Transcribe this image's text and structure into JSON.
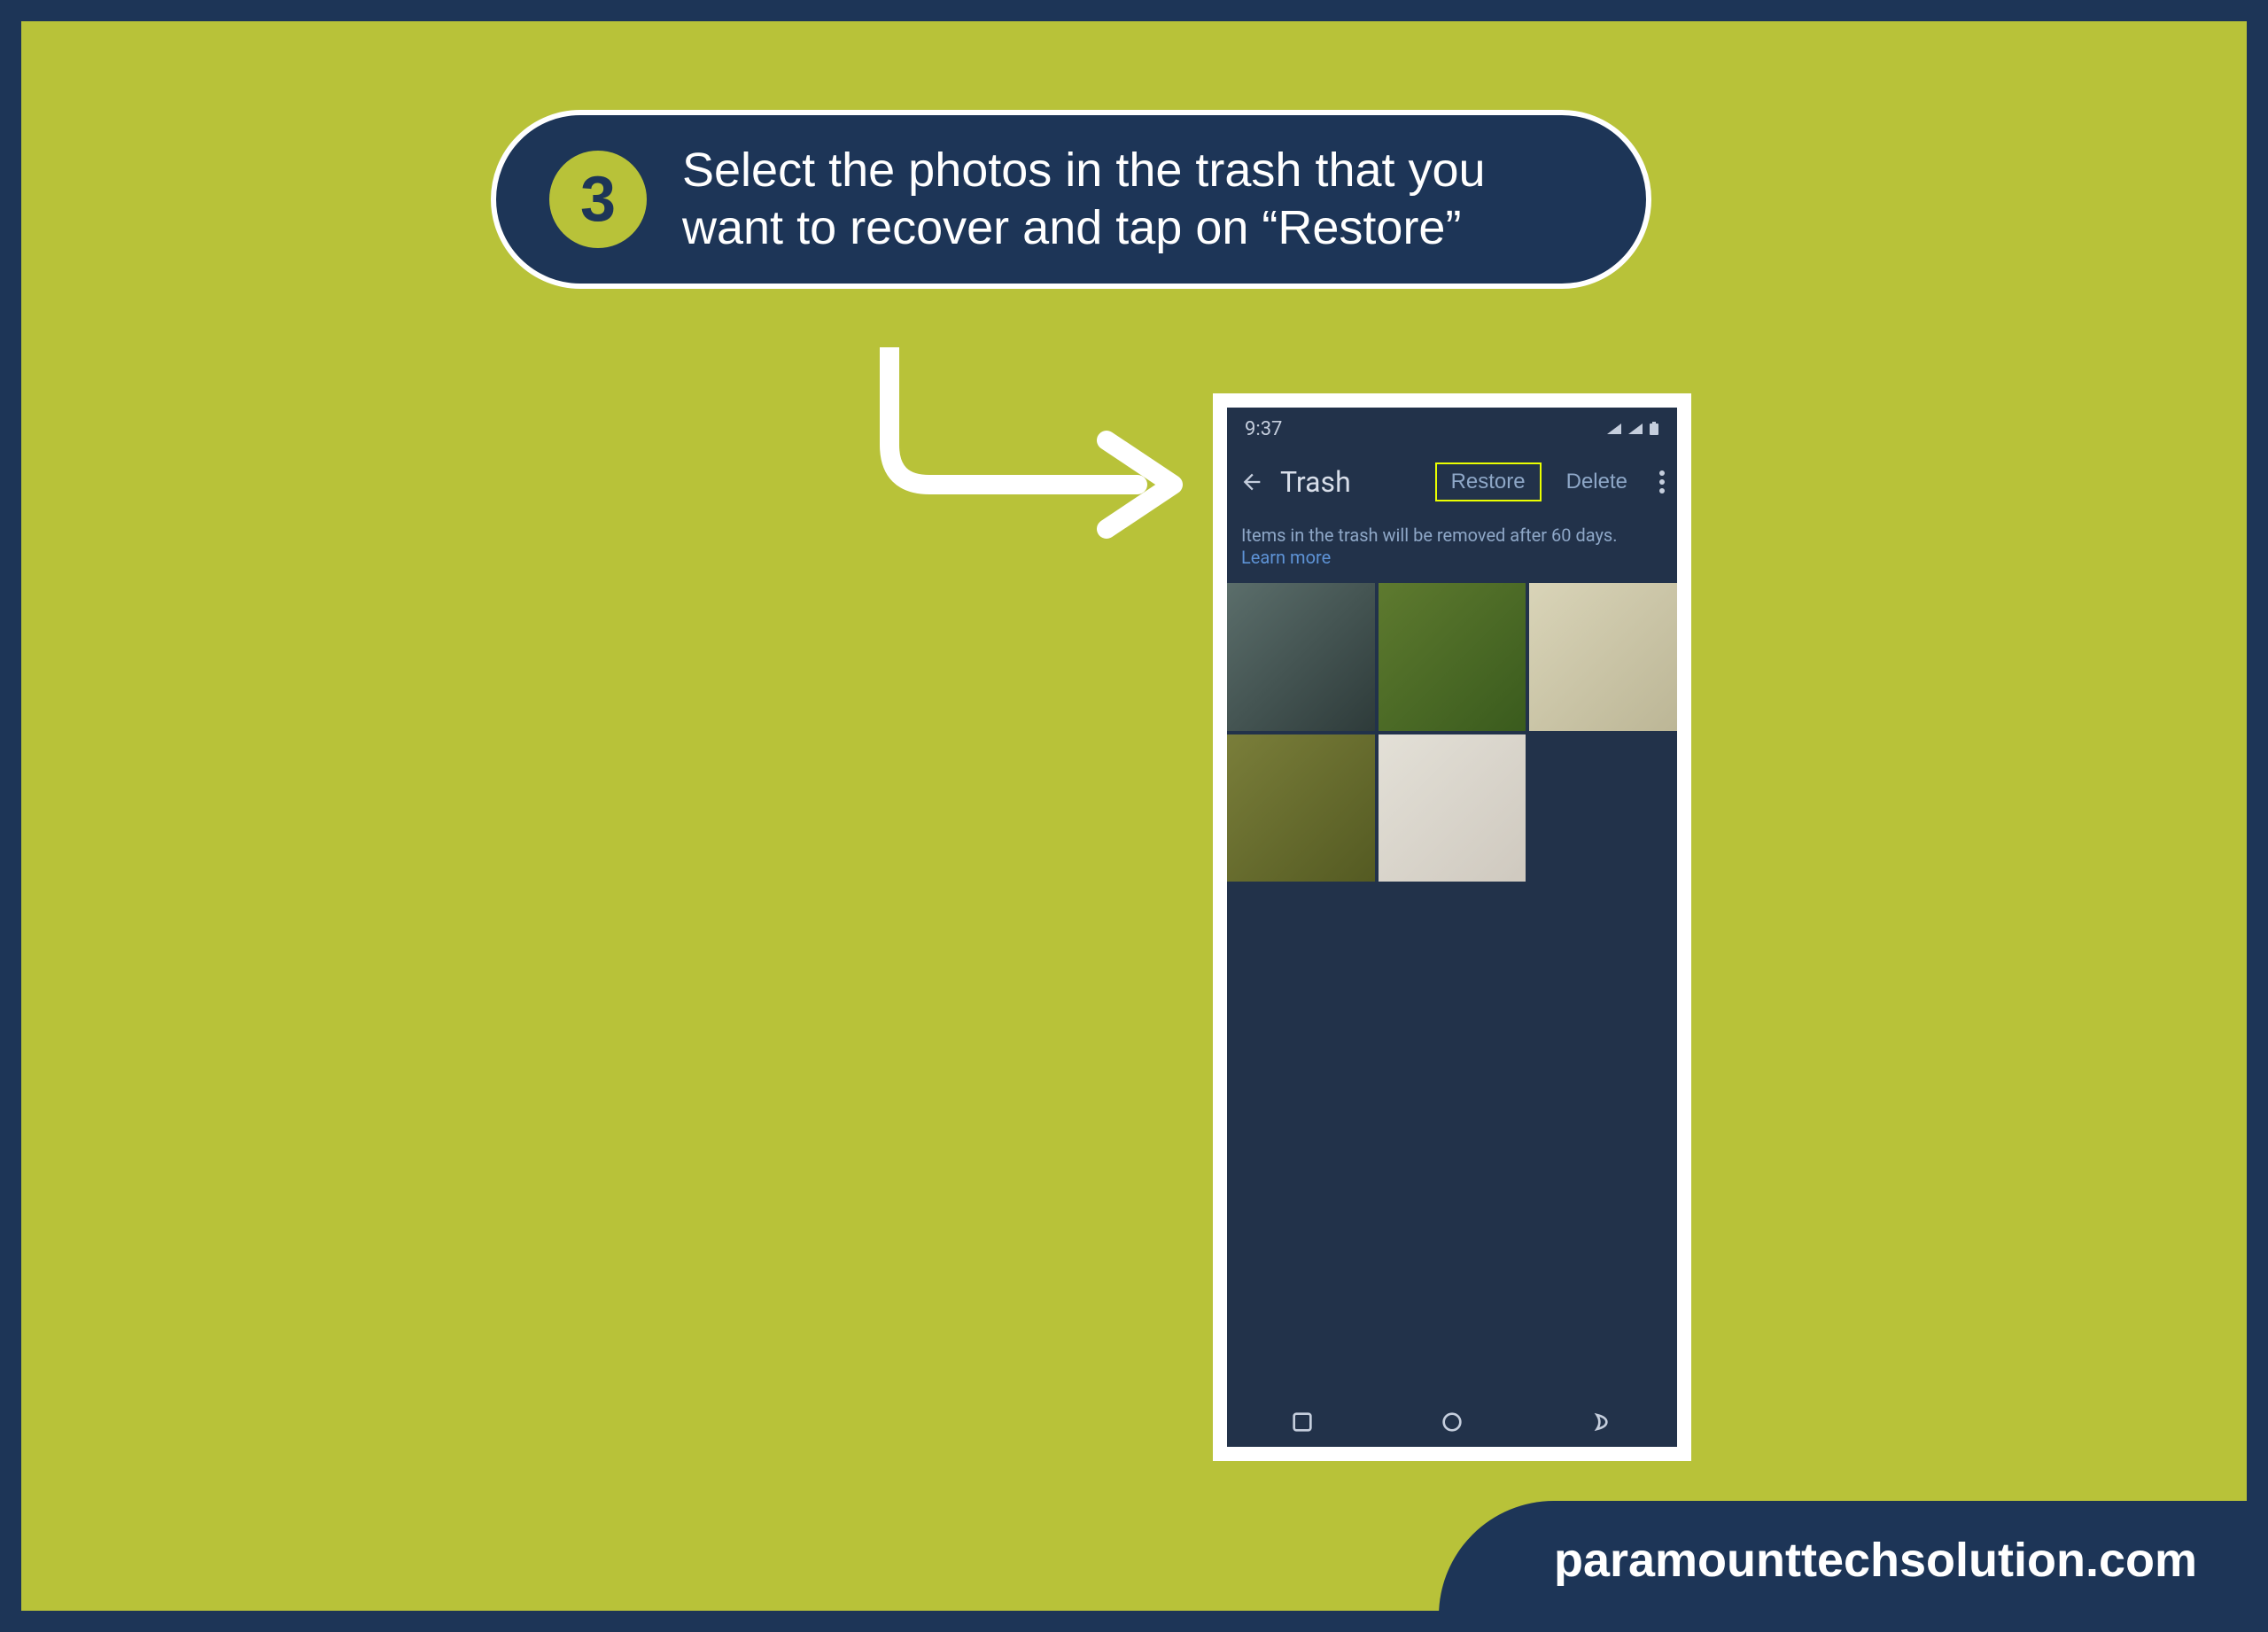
{
  "step": {
    "number": "3",
    "text": "Select the photos in the trash that you want to recover and tap on “Restore”"
  },
  "phone": {
    "statusbar": {
      "time": "9:37"
    },
    "appbar": {
      "title": "Trash",
      "restore_label": "Restore",
      "delete_label": "Delete"
    },
    "info": {
      "line1": "Items in the trash will be removed after 60 days.",
      "learn_more": "Learn more"
    }
  },
  "footer": {
    "domain": "paramounttechsolution.com"
  }
}
